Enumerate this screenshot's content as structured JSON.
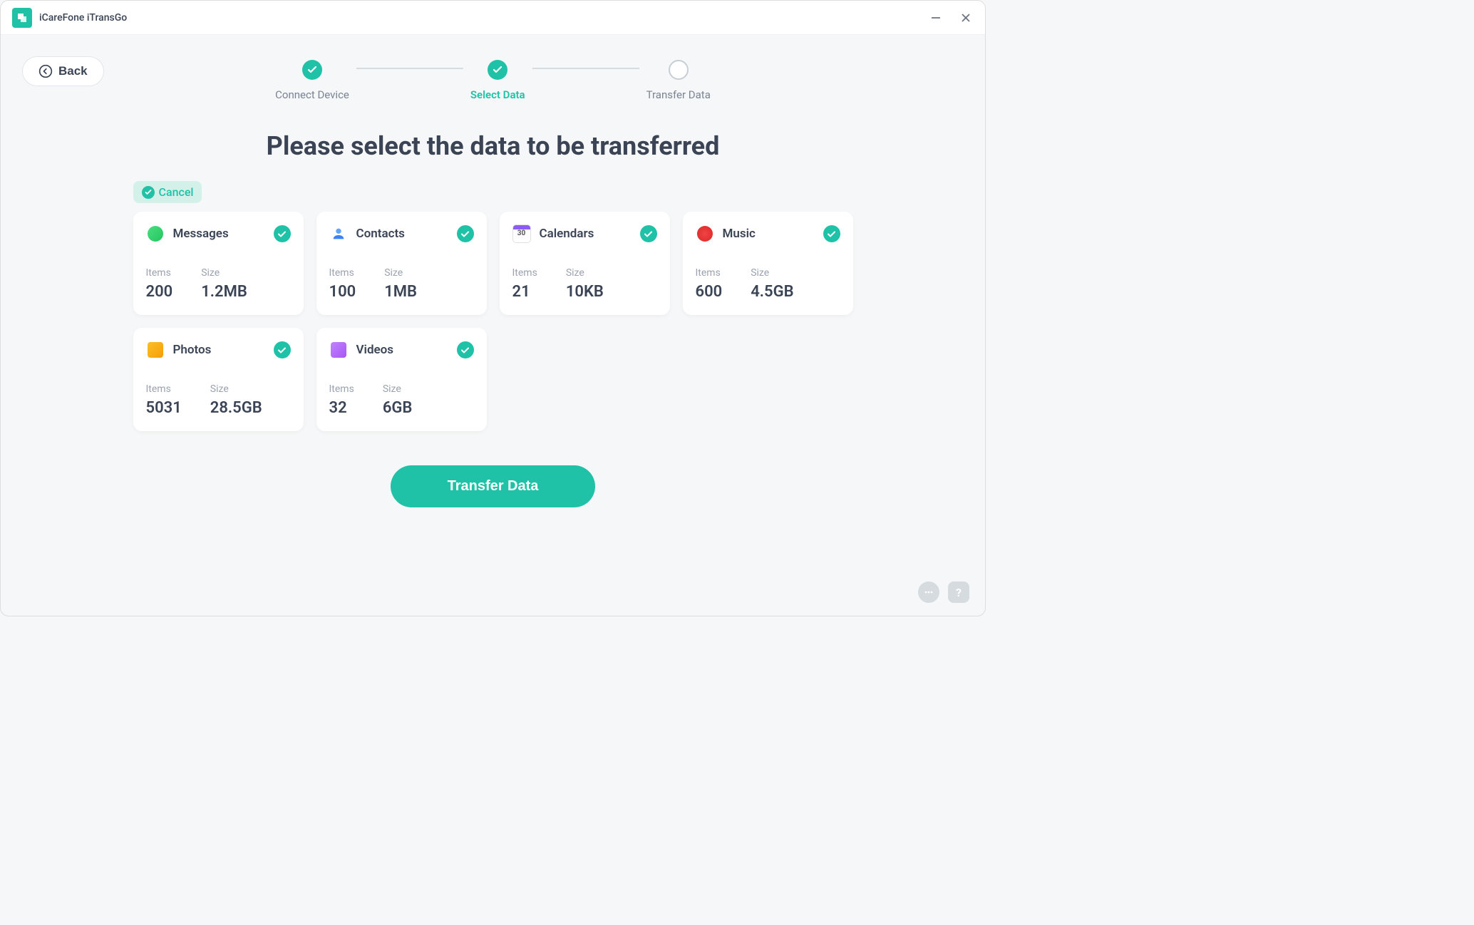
{
  "app": {
    "title": "iCareFone iTransGo"
  },
  "back": {
    "label": "Back"
  },
  "stepper": {
    "steps": [
      {
        "label": "Connect Device",
        "state": "done"
      },
      {
        "label": "Select Data",
        "state": "active"
      },
      {
        "label": "Transfer Data",
        "state": "pending"
      }
    ]
  },
  "heading": "Please select the data to be transferred",
  "cancel": {
    "label": "Cancel"
  },
  "labels": {
    "items": "Items",
    "size": "Size"
  },
  "cards": [
    {
      "key": "messages",
      "title": "Messages",
      "items": "200",
      "size": "1.2MB",
      "checked": true
    },
    {
      "key": "contacts",
      "title": "Contacts",
      "items": "100",
      "size": "1MB",
      "checked": true
    },
    {
      "key": "calendars",
      "title": "Calendars",
      "items": "21",
      "size": "10KB",
      "checked": true
    },
    {
      "key": "music",
      "title": "Music",
      "items": "600",
      "size": "4.5GB",
      "checked": true
    },
    {
      "key": "photos",
      "title": "Photos",
      "items": "5031",
      "size": "28.5GB",
      "checked": true
    },
    {
      "key": "videos",
      "title": "Videos",
      "items": "32",
      "size": "6GB",
      "checked": true
    }
  ],
  "cta": {
    "label": "Transfer Data"
  },
  "footer": {
    "help": "?",
    "chat": "…"
  }
}
